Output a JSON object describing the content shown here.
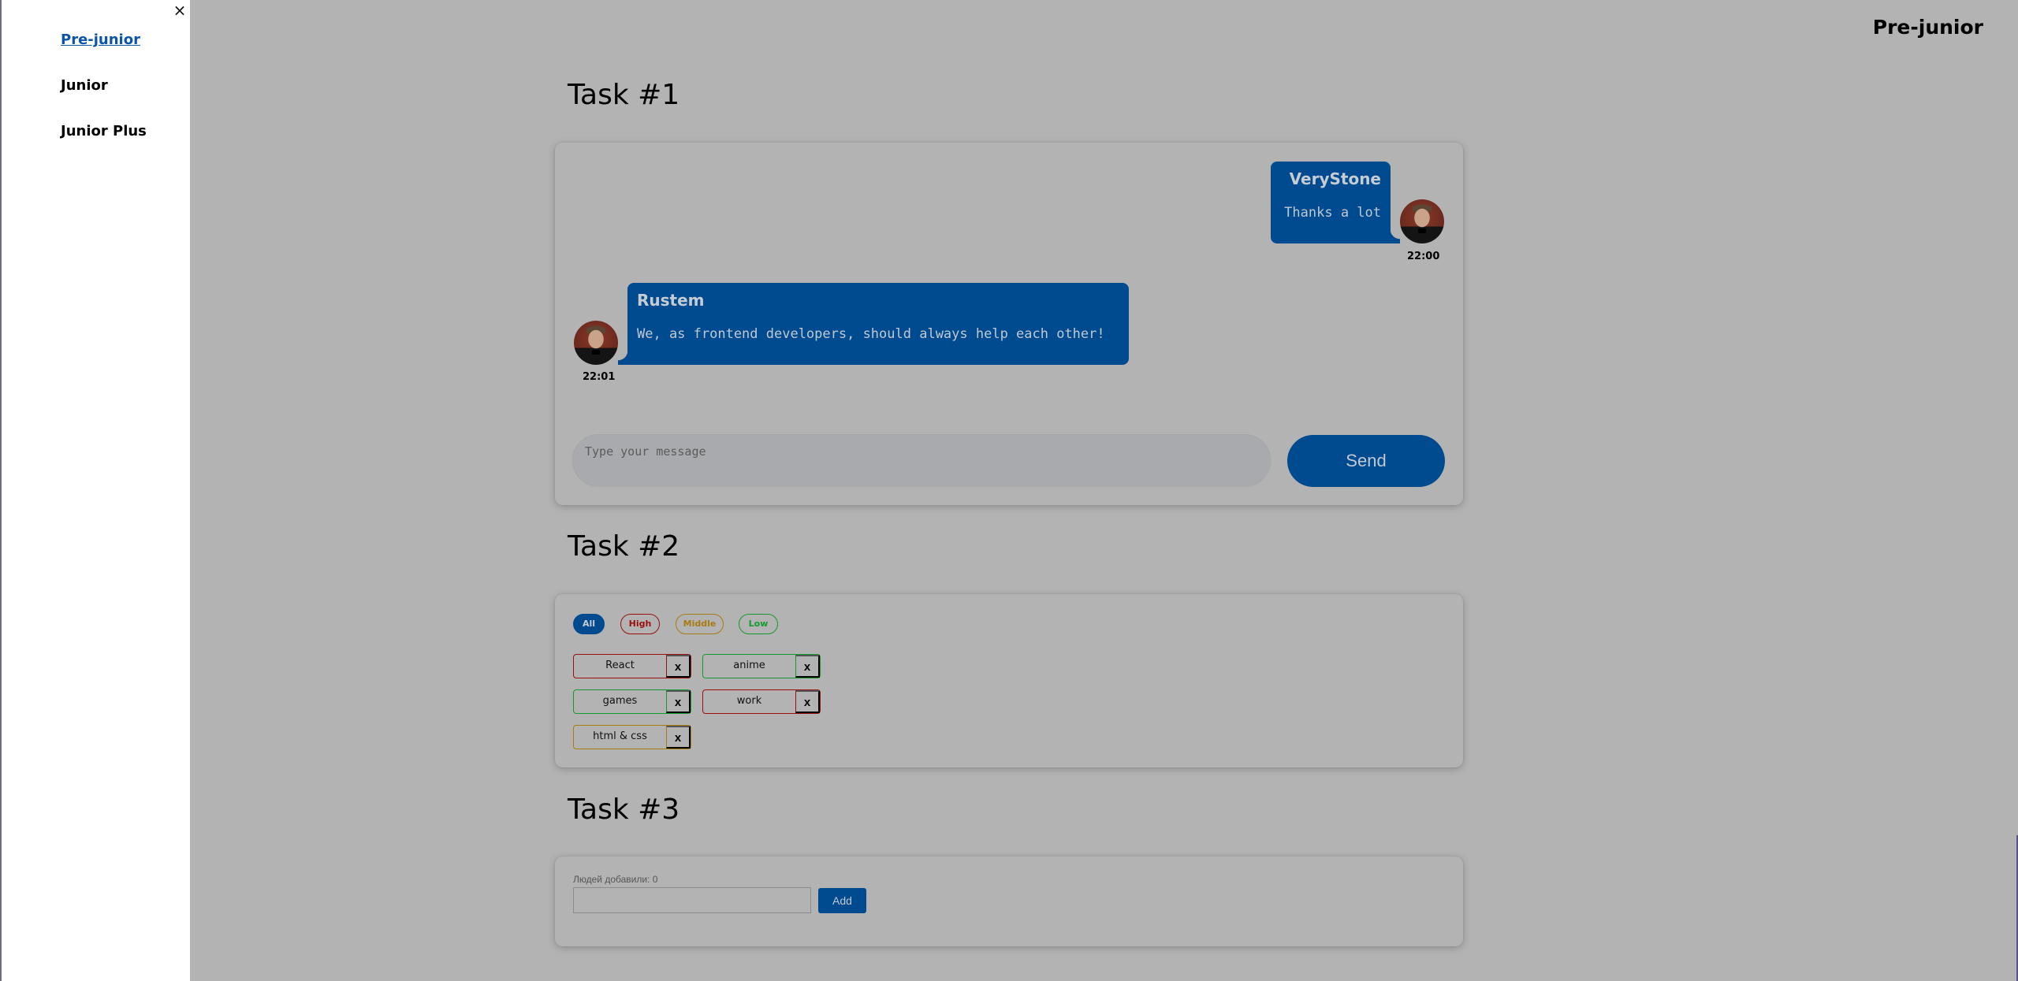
{
  "sidebar": {
    "close_icon": "×",
    "items": [
      {
        "label": "Pre-junior",
        "active": true
      },
      {
        "label": "Junior",
        "active": false
      },
      {
        "label": "Junior Plus",
        "active": false
      }
    ]
  },
  "header": {
    "title": "Pre-junior"
  },
  "task1": {
    "title": "Task #1",
    "messages": [
      {
        "author": "VeryStone",
        "text": "Thanks a lot",
        "time": "22:00",
        "side": "right"
      },
      {
        "author": "Rustem",
        "text": "We, as frontend developers, should always help each other!",
        "time": "22:01",
        "side": "left"
      }
    ],
    "input_placeholder": "Type your message",
    "input_value": "",
    "send_label": "Send"
  },
  "task2": {
    "title": "Task #2",
    "filters": [
      {
        "label": "All",
        "selected": true
      },
      {
        "label": "High"
      },
      {
        "label": "Middle"
      },
      {
        "label": "Low"
      }
    ],
    "affairs": [
      {
        "name": "React",
        "priority": "high"
      },
      {
        "name": "anime",
        "priority": "low"
      },
      {
        "name": "games",
        "priority": "low"
      },
      {
        "name": "work",
        "priority": "high"
      },
      {
        "name": "html & css",
        "priority": "middle"
      }
    ],
    "delete_label": "x"
  },
  "task3": {
    "title": "Task #3",
    "counter_label": "Людей добавили: 0",
    "input_value": "",
    "add_label": "Add"
  },
  "colors": {
    "accent": "#004b8f",
    "high": "#9a1010",
    "middle": "#a87c10",
    "low": "#149a2e",
    "background": "#b3b3b3"
  }
}
